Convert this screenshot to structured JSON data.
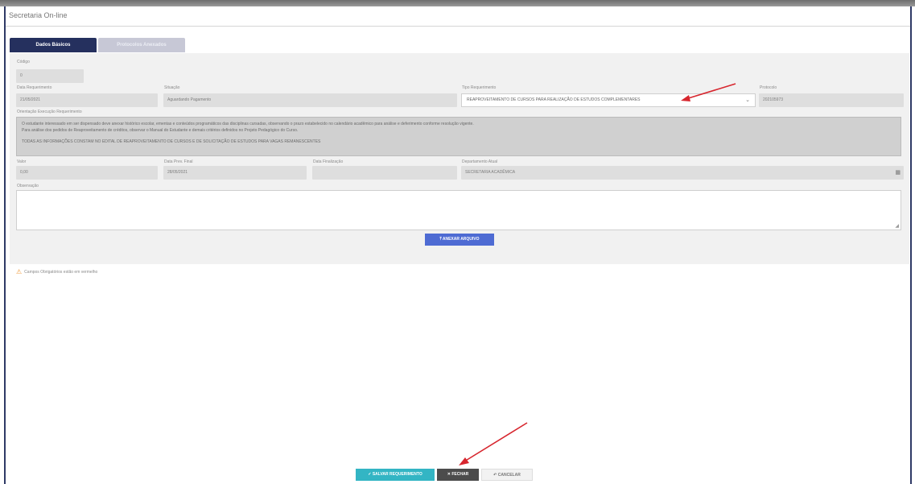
{
  "window": {
    "title": "Secretaria On-line"
  },
  "tabs": [
    {
      "label": "Dados Básicos"
    },
    {
      "label": "Protocolos Anexados"
    }
  ],
  "form": {
    "codigo": {
      "label": "Código",
      "value": "0"
    },
    "data_requerimento": {
      "label": "Data Requerimento",
      "value": "21/05/2021"
    },
    "situacao": {
      "label": "Situação",
      "value": "Aguardando Pagamento"
    },
    "tipo_requerimento": {
      "label": "Tipo Requerimento",
      "value": "REAPROVEITAMENTO DE CURSOS PARA REALIZAÇÃO DE ESTUDOS COMPLEMENTARES"
    },
    "protocolo": {
      "label": "Protocolo",
      "value": "202105973"
    },
    "orientacao": {
      "label": "Orientação Execução Requerimento",
      "paragraphs": [
        "O estudante interessado em ser dispensado deve anexar histórico escolar, ementas e conteúdos programáticos das disciplinas cursadas, observando o prazo estabelecido no calendário acadêmico para análise e deferimento conforme resolução vigente.",
        "Para análise dos pedidos de Reaproveitamento de créditos, observar o Manual do Estudante e demais critérios definidos no Projeto Pedagógico do Curso.",
        "TODAS AS INFORMAÇÕES CONSTAM NO EDITAL DE REAPROVEITAMENTO DE CURSOS E DE SOLICITAÇÃO DE ESTUDOS PARA VAGAS REMANESCENTES"
      ]
    },
    "valor": {
      "label": "Valor",
      "value": "0,00"
    },
    "data_prev_final": {
      "label": "Data Prev. Final",
      "value": "28/05/2021"
    },
    "data_finalizacao": {
      "label": "Data Finalização",
      "value": ""
    },
    "departamento": {
      "label": "Departamento Atual",
      "value": "SECRETARIA ACADÊMICA"
    },
    "observacao": {
      "label": "Observação",
      "value": ""
    }
  },
  "buttons": {
    "attach": "ANEXAR ARQUIVO",
    "save": "SALVAR REQUERIMENTO",
    "close": "FECHAR",
    "cancel": "CANCELAR"
  },
  "notes": {
    "required": "Campos Obrigatórios estão em vermelho"
  },
  "colors": {
    "accent": "#25305e",
    "attach_button": "#4e6bd3",
    "save_button": "#33b5c4",
    "annotation_arrow": "#d7262e"
  }
}
